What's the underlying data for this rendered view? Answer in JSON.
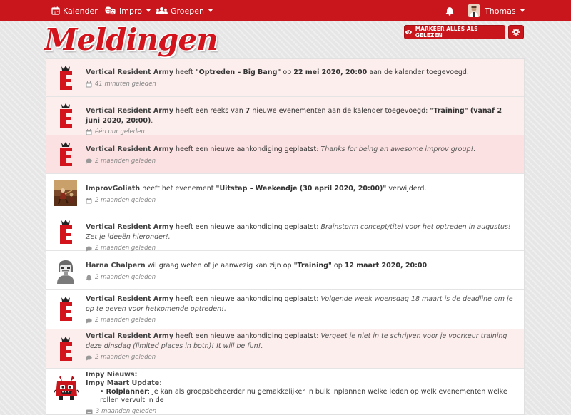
{
  "nav": {
    "calendar": "Kalender",
    "impro": "Impro",
    "groups": "Groepen",
    "user": "Thomas"
  },
  "page": {
    "title": "Meldingen",
    "mark_read": "MARKEER ALLES ALS GELEZEN"
  },
  "notifications": [
    {
      "who": "Vertical Resident Army",
      "pre": " heeft ",
      "q1": "\"Optreden – Big Bang\"",
      "mid": " op ",
      "q2": "22 mei 2020, 20:00",
      "post": " aan de kalender toegevoegd.",
      "time": "41 minuten geleden",
      "icon": "calendar-icon"
    },
    {
      "who": "Vertical Resident Army",
      "pre": " heeft een reeks van ",
      "q1": "7",
      "mid": " nieuwe evenementen aan de kalender toegevoegd: ",
      "q2": "\"Training\" (vanaf 2 juni 2020, 20:00)",
      "post": ".",
      "time": "één uur geleden",
      "icon": "calendar-icon"
    },
    {
      "who": "Vertical Resident Army",
      "pre": " heeft een nieuwe aankondiging geplaatst: ",
      "msg": "Thanks for being an awesome improv group!.",
      "time": "2 maanden geleden",
      "icon": "comment-icon"
    },
    {
      "who": "ImprovGoliath",
      "pre": " heeft het evenement ",
      "q1": "\"Uitstap – Weekendje (30 april 2020, 20:00)\"",
      "post": " verwijderd.",
      "time": "2 maanden geleden",
      "icon": "calendar-icon"
    },
    {
      "who": "Vertical Resident Army",
      "pre": " heeft een nieuwe aankondiging geplaatst: ",
      "msg": "Brainstorm concept/titel voor het optreden in augustus! Zet je ideeën hieronder!.",
      "time": "2 maanden geleden",
      "icon": "comment-icon"
    },
    {
      "who": "Harna Chalpern",
      "pre": " wil graag weten of je aanwezig kan zijn op ",
      "q1": "\"Training\"",
      "mid": " op ",
      "q2": "12 maart 2020, 20:00",
      "post": ".",
      "time": "2 maanden geleden",
      "icon": "bell-icon"
    },
    {
      "who": "Vertical Resident Army",
      "pre": " heeft een nieuwe aankondiging geplaatst: ",
      "msg": "Volgende week woensdag 18 maart is de deadline om je op te geven voor hetkomende optreden!.",
      "time": "2 maanden geleden",
      "icon": "comment-icon"
    },
    {
      "who": "Vertical Resident Army",
      "pre": " heeft een nieuwe aankondiging geplaatst: ",
      "msg": "Vergeet je niet in te schrijven voor je voorkeur training deze dinsdag (limited places in both)! It will be fun!.",
      "time": "2 maanden geleden",
      "icon": "comment-icon"
    },
    {
      "line1": "Impy Nieuws:",
      "line2": "Impy Maart Update:",
      "bullet_b": "Rolplanner",
      "bullet_t": ": Je kan als groepsbeheerder nu gemakkelijker in bulk inplannen welke leden op welk evenementen welke rollen vervult in de",
      "time": "3 maanden geleden",
      "icon": "news-icon"
    }
  ]
}
